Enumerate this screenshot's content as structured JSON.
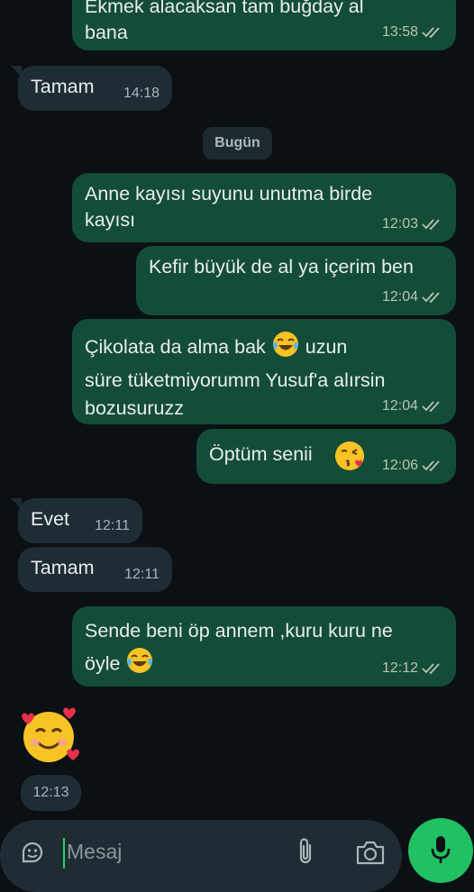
{
  "messages": [
    {
      "text": "Ekmek alacaksan tam buğday al\nbana",
      "time": "13:58",
      "dir": "out"
    },
    {
      "text": "Tamam",
      "time": "14:18",
      "dir": "in"
    },
    {
      "text": "Anne kayısı suyunu unutma birde\nkayısı",
      "time": "12:03",
      "dir": "out"
    },
    {
      "text": "Kefir büyük de al ya içerim ben",
      "time": "12:04",
      "dir": "out"
    },
    {
      "text_a": "Çikolata da alma bak",
      "text_b": "uzun",
      "text_c": "süre tüketmiyorumm Yusuf'a alırsin\nbozusuruzz",
      "time": "12:04",
      "dir": "out",
      "emoji": "tears-of-joy-emoji"
    },
    {
      "text": "Öptüm senii",
      "time": "12:06",
      "dir": "out",
      "emoji": "blowing-kiss-emoji"
    },
    {
      "text": "Evet",
      "time": "12:11",
      "dir": "in"
    },
    {
      "text": "Tamam",
      "time": "12:11",
      "dir": "in"
    },
    {
      "text_a": "Sende beni öp annem ,kuru kuru ne",
      "text_b": "öyle",
      "time": "12:12",
      "dir": "out",
      "emoji": "tears-of-joy-emoji"
    },
    {
      "emoji": "smiling-face-with-hearts-emoji",
      "time": "12:13",
      "dir": "in"
    }
  ],
  "date_separator": "Bugün",
  "composer": {
    "placeholder": "Mesaj"
  },
  "colors": {
    "outgoing": "#144d37",
    "incoming": "#1f2c33",
    "accent": "#21c063",
    "background": "#0b1014"
  }
}
